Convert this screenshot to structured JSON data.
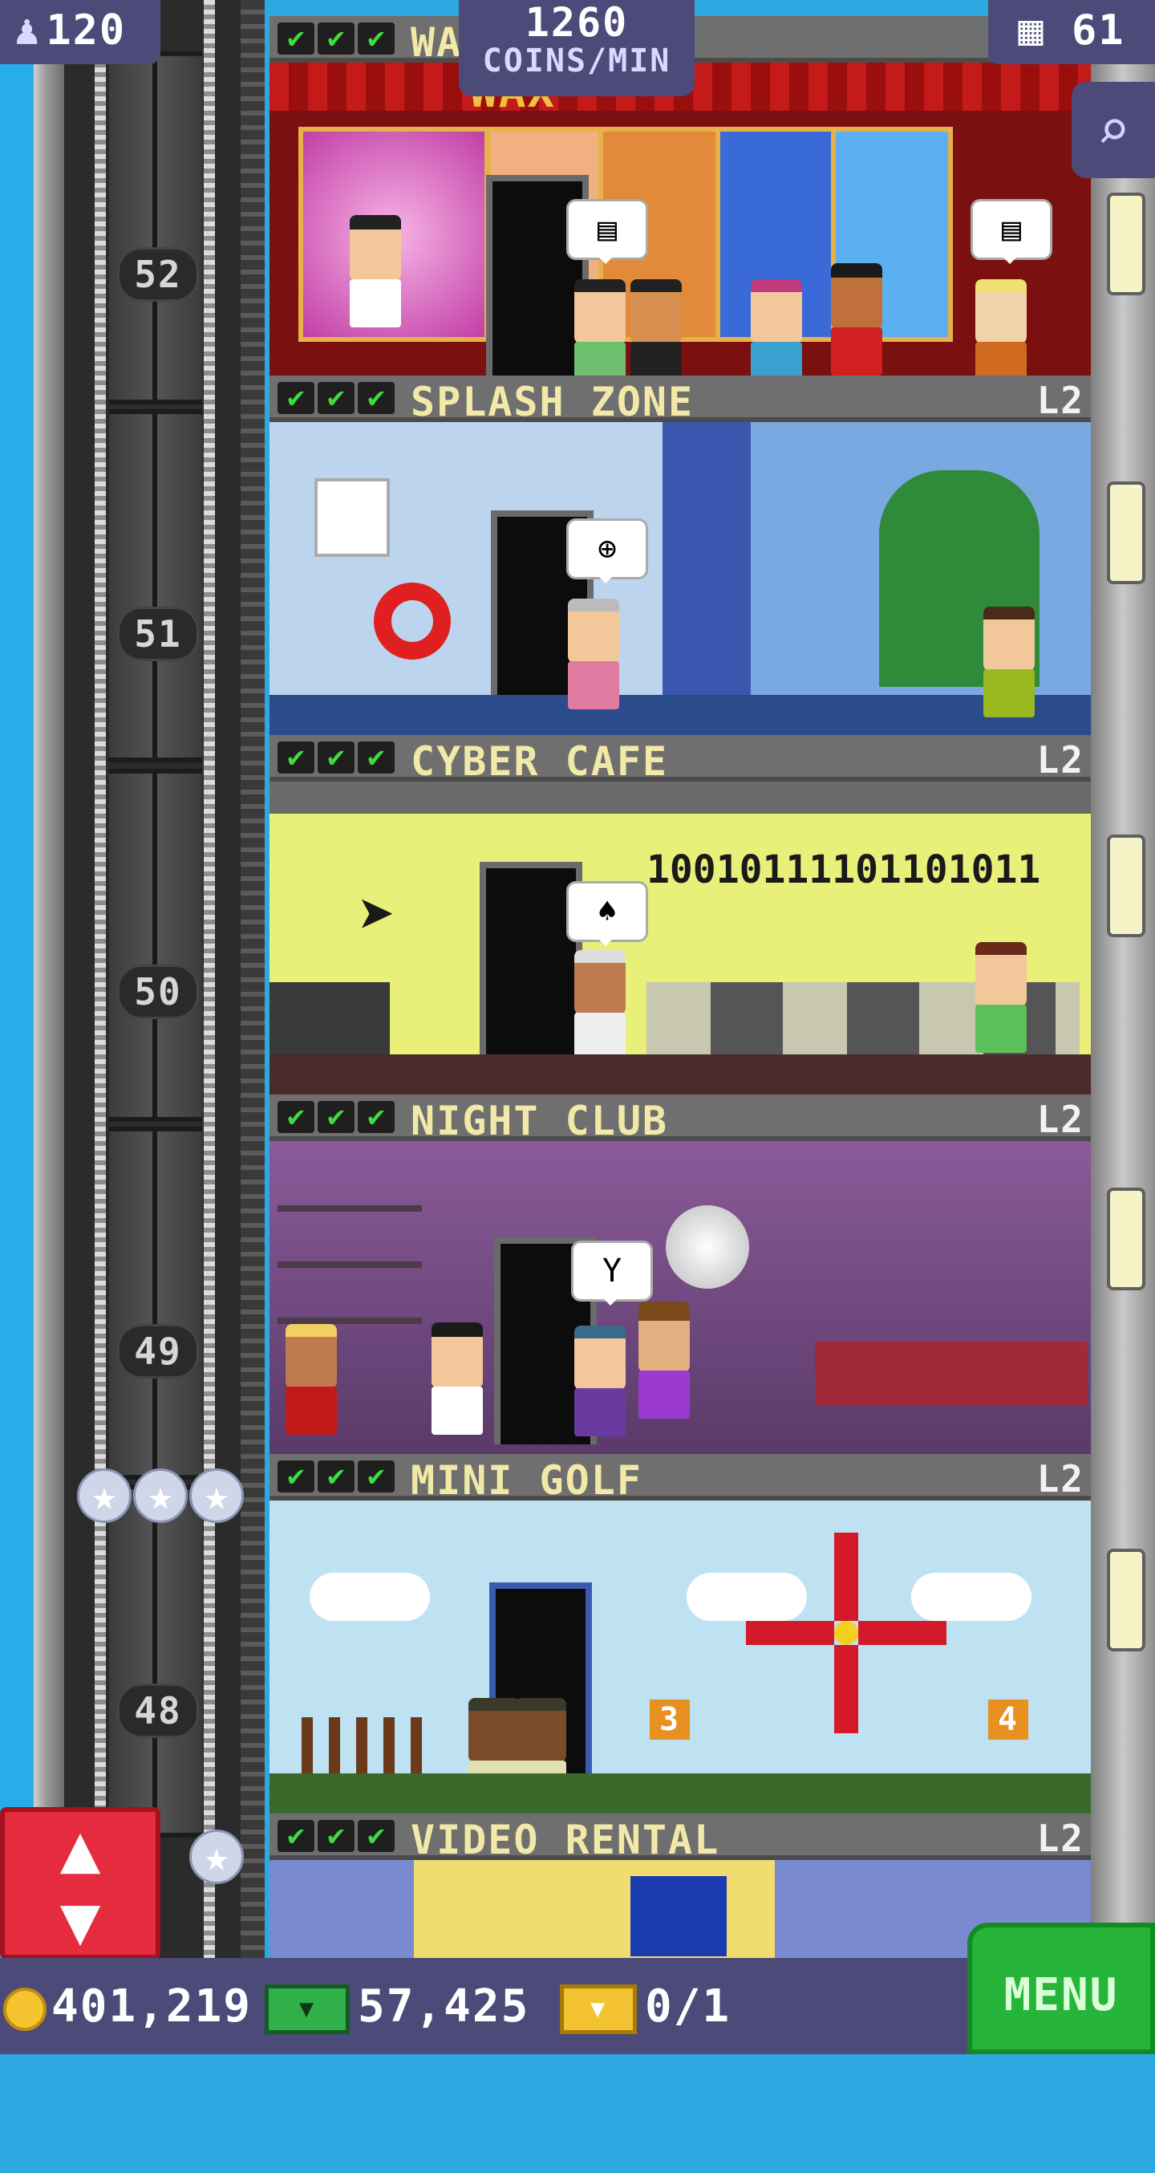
{
  "hud": {
    "population": "120",
    "coins_per_min": "1260",
    "coins_per_min_label": "COINS/MIN",
    "floors": "61",
    "coins": "401,219",
    "bux": "57,425",
    "tickets": "0/1",
    "menu_label": "MENU"
  },
  "floor_numbers": [
    "52",
    "51",
    "50",
    "49",
    "48"
  ],
  "floors": [
    {
      "name": "WAX MUSEUM",
      "level": "L2",
      "checks": 3,
      "sign": "WAX",
      "bubble": "▤"
    },
    {
      "name": "SPLASH ZONE",
      "level": "L2",
      "checks": 3,
      "bubble": "⊕"
    },
    {
      "name": "CYBER CAFE",
      "level": "L2",
      "checks": 3,
      "binary": "10010111101101011",
      "bubble": "♠"
    },
    {
      "name": "NIGHT CLUB",
      "level": "L2",
      "checks": 3,
      "bubble": "Y"
    },
    {
      "name": "MINI GOLF",
      "level": "L2",
      "checks": 3,
      "holes": [
        "3",
        "4"
      ]
    },
    {
      "name": "VIDEO RENTAL",
      "level": "L2",
      "checks": 3
    }
  ],
  "colors": {
    "hud_bg": "#4b4a78",
    "menu_green": "#27b43a",
    "elevator_red": "#e52b3e",
    "floor_title": "#f2e9a8",
    "check_green": "#3edc3e"
  },
  "icons": [
    "person-icon",
    "building-icon",
    "zoom-icon",
    "coin-icon",
    "bux-icon",
    "ticket-icon",
    "elevator-arrows-icon",
    "star-icon"
  ]
}
